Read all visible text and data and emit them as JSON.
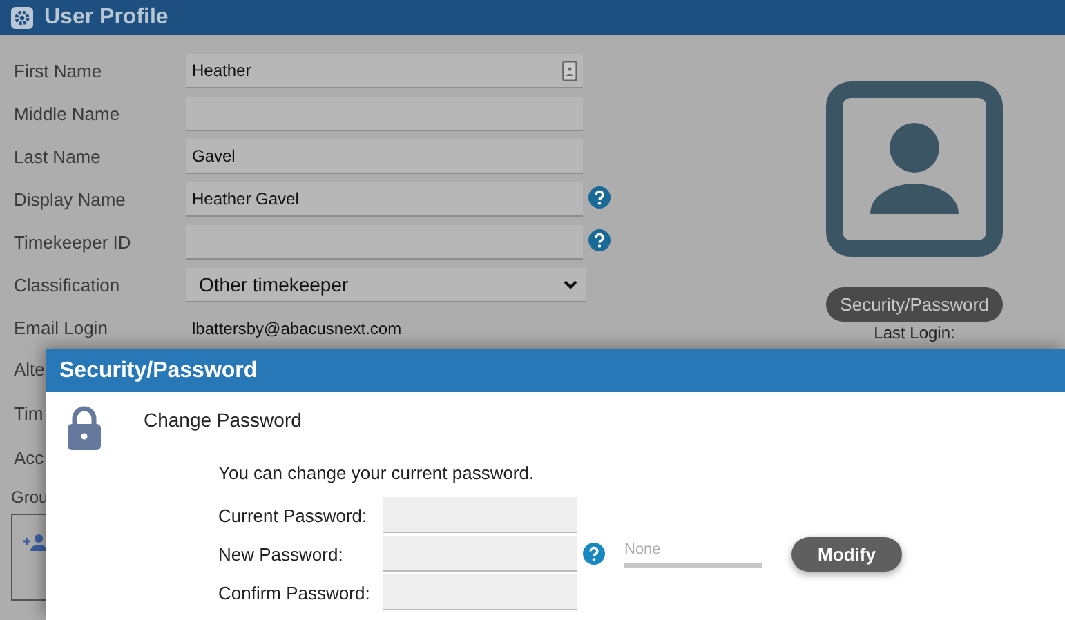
{
  "header": {
    "title": "User Profile"
  },
  "fields": [
    {
      "label": "First Name",
      "value": "Heather",
      "kind": "contact",
      "help": false
    },
    {
      "label": "Middle Name",
      "kind": "text",
      "help": false
    },
    {
      "label": "Last Name",
      "value": "Gavel",
      "kind": "text",
      "help": false
    },
    {
      "label": "Display Name",
      "value": "Heather Gavel",
      "kind": "text",
      "help": true
    },
    {
      "label": "Timekeeper ID",
      "kind": "text",
      "help": true
    },
    {
      "label": "Classification",
      "value": "Other timekeeper",
      "kind": "select",
      "help": false
    },
    {
      "label": "Email Login",
      "value": "lbattersby@abacusnext.com",
      "kind": "plain",
      "help": false
    }
  ],
  "hidden_labels": [
    "Alte",
    "Tim",
    "Acc"
  ],
  "groups": {
    "label": "Grou"
  },
  "profile": {
    "button": "Security/Password",
    "last_login": "Last Login:"
  },
  "dialog": {
    "title": "Security/Password",
    "heading": "Change Password",
    "intro": "You can change your current password.",
    "fields": [
      {
        "label": "Current Password:",
        "help": false
      },
      {
        "label": "New Password:",
        "help": true
      },
      {
        "label": "Confirm Password:",
        "help": false
      }
    ],
    "strength": {
      "label": "None",
      "level": 0
    },
    "button": "Modify"
  }
}
